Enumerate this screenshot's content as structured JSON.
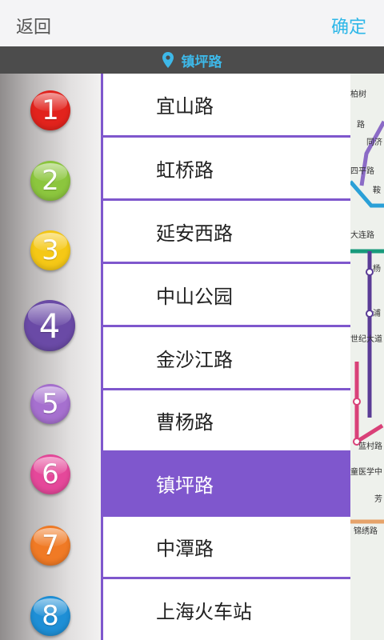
{
  "header": {
    "back_label": "返回",
    "confirm_label": "确定"
  },
  "current_station": {
    "label": "镇坪路",
    "pin_icon": "location-pin-icon"
  },
  "lines": [
    {
      "label": "1",
      "color": "#e2231d"
    },
    {
      "label": "2",
      "color": "#8cc63e"
    },
    {
      "label": "3",
      "color": "#f5c816"
    },
    {
      "label": "4",
      "color": "#6a4aa6"
    },
    {
      "label": "5",
      "color": "#a670cf"
    },
    {
      "label": "6",
      "color": "#e5489a"
    },
    {
      "label": "7",
      "color": "#f07a25"
    },
    {
      "label": "8",
      "color": "#1e8fd6"
    }
  ],
  "selected_line": "4",
  "stations": [
    {
      "label": "宜山路"
    },
    {
      "label": "虹桥路"
    },
    {
      "label": "延安西路"
    },
    {
      "label": "中山公园"
    },
    {
      "label": "金沙江路"
    },
    {
      "label": "曹杨路"
    },
    {
      "label": "镇坪路",
      "selected": true
    },
    {
      "label": "中潭路"
    },
    {
      "label": "上海火车站"
    }
  ],
  "accent_color": "#7f57cd",
  "map_labels": [
    "柏树",
    "路",
    "同济",
    "四平路",
    "鞍",
    "大连路",
    "杨",
    "浦",
    "世纪大道",
    "蓝村路",
    "童医学中",
    "芳",
    "锦绣路"
  ]
}
